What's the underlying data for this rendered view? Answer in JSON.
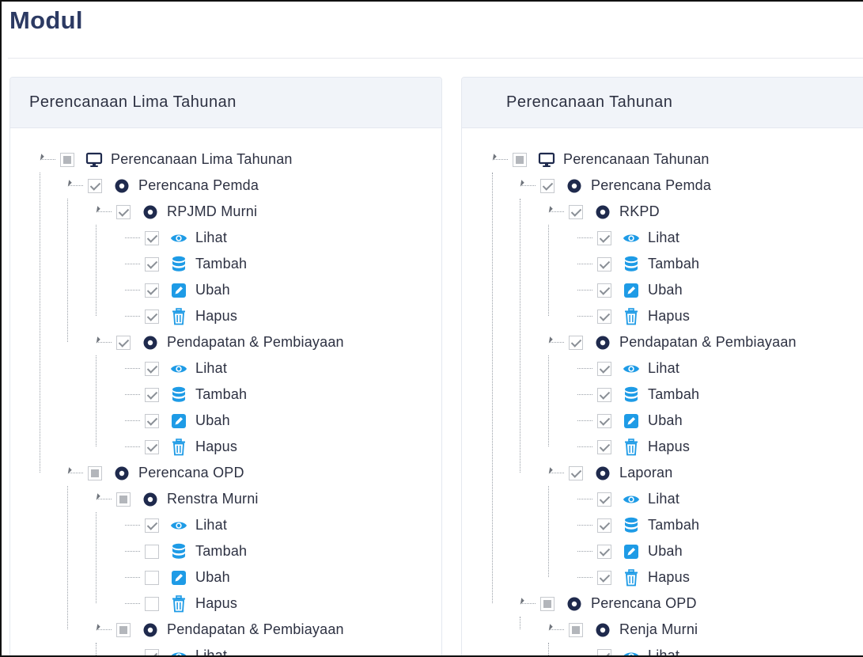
{
  "page": {
    "title": "Modul"
  },
  "colors": {
    "accent": "#1e9be6",
    "navy": "#1f2a4d",
    "title": "#2c3a63"
  },
  "panels": [
    {
      "header": "Perencanaan Lima Tahunan",
      "nodes": [
        {
          "label": "Perencanaan Lima Tahunan",
          "level": 0,
          "state": "partial",
          "icon": "monitor-icon",
          "collapsible": true
        },
        {
          "label": "Perencana Pemda",
          "level": 1,
          "state": "checked",
          "icon": "dot-circle-icon",
          "collapsible": true
        },
        {
          "label": "RPJMD Murni",
          "level": 2,
          "state": "checked",
          "icon": "dot-circle-icon",
          "collapsible": true
        },
        {
          "label": "Lihat",
          "level": 3,
          "state": "checked",
          "icon": "eye-icon"
        },
        {
          "label": "Tambah",
          "level": 3,
          "state": "checked",
          "icon": "database-icon"
        },
        {
          "label": "Ubah",
          "level": 3,
          "state": "checked",
          "icon": "edit-icon"
        },
        {
          "label": "Hapus",
          "level": 3,
          "state": "checked",
          "icon": "trash-icon"
        },
        {
          "label": "Pendapatan & Pembiayaan",
          "level": 2,
          "state": "checked",
          "icon": "dot-circle-icon",
          "collapsible": true
        },
        {
          "label": "Lihat",
          "level": 3,
          "state": "checked",
          "icon": "eye-icon"
        },
        {
          "label": "Tambah",
          "level": 3,
          "state": "checked",
          "icon": "database-icon"
        },
        {
          "label": "Ubah",
          "level": 3,
          "state": "checked",
          "icon": "edit-icon"
        },
        {
          "label": "Hapus",
          "level": 3,
          "state": "checked",
          "icon": "trash-icon"
        },
        {
          "label": "Perencana OPD",
          "level": 1,
          "state": "partial",
          "icon": "dot-circle-icon",
          "collapsible": true
        },
        {
          "label": "Renstra Murni",
          "level": 2,
          "state": "partial",
          "icon": "dot-circle-icon",
          "collapsible": true
        },
        {
          "label": "Lihat",
          "level": 3,
          "state": "checked",
          "icon": "eye-icon"
        },
        {
          "label": "Tambah",
          "level": 3,
          "state": "unchecked",
          "icon": "database-icon"
        },
        {
          "label": "Ubah",
          "level": 3,
          "state": "unchecked",
          "icon": "edit-icon"
        },
        {
          "label": "Hapus",
          "level": 3,
          "state": "unchecked",
          "icon": "trash-icon"
        },
        {
          "label": "Pendapatan & Pembiayaan",
          "level": 2,
          "state": "partial",
          "icon": "dot-circle-icon",
          "collapsible": true
        },
        {
          "label": "Lihat",
          "level": 3,
          "state": "checked",
          "icon": "eye-icon"
        }
      ]
    },
    {
      "header": "Perencanaan Tahunan",
      "nodes": [
        {
          "label": "Perencanaan Tahunan",
          "level": 0,
          "state": "partial",
          "icon": "monitor-icon",
          "collapsible": true
        },
        {
          "label": "Perencana Pemda",
          "level": 1,
          "state": "checked",
          "icon": "dot-circle-icon",
          "collapsible": true
        },
        {
          "label": "RKPD",
          "level": 2,
          "state": "checked",
          "icon": "dot-circle-icon",
          "collapsible": true
        },
        {
          "label": "Lihat",
          "level": 3,
          "state": "checked",
          "icon": "eye-icon"
        },
        {
          "label": "Tambah",
          "level": 3,
          "state": "checked",
          "icon": "database-icon"
        },
        {
          "label": "Ubah",
          "level": 3,
          "state": "checked",
          "icon": "edit-icon"
        },
        {
          "label": "Hapus",
          "level": 3,
          "state": "checked",
          "icon": "trash-icon"
        },
        {
          "label": "Pendapatan & Pembiayaan",
          "level": 2,
          "state": "checked",
          "icon": "dot-circle-icon",
          "collapsible": true
        },
        {
          "label": "Lihat",
          "level": 3,
          "state": "checked",
          "icon": "eye-icon"
        },
        {
          "label": "Tambah",
          "level": 3,
          "state": "checked",
          "icon": "database-icon"
        },
        {
          "label": "Ubah",
          "level": 3,
          "state": "checked",
          "icon": "edit-icon"
        },
        {
          "label": "Hapus",
          "level": 3,
          "state": "checked",
          "icon": "trash-icon"
        },
        {
          "label": "Laporan",
          "level": 2,
          "state": "checked",
          "icon": "dot-circle-icon",
          "collapsible": true
        },
        {
          "label": "Lihat",
          "level": 3,
          "state": "checked",
          "icon": "eye-icon"
        },
        {
          "label": "Tambah",
          "level": 3,
          "state": "checked",
          "icon": "database-icon"
        },
        {
          "label": "Ubah",
          "level": 3,
          "state": "checked",
          "icon": "edit-icon"
        },
        {
          "label": "Hapus",
          "level": 3,
          "state": "checked",
          "icon": "trash-icon"
        },
        {
          "label": "Perencana OPD",
          "level": 1,
          "state": "partial",
          "icon": "dot-circle-icon",
          "collapsible": true
        },
        {
          "label": "Renja Murni",
          "level": 2,
          "state": "partial",
          "icon": "dot-circle-icon",
          "collapsible": true
        },
        {
          "label": "Lihat",
          "level": 3,
          "state": "checked",
          "icon": "eye-icon"
        }
      ]
    }
  ]
}
